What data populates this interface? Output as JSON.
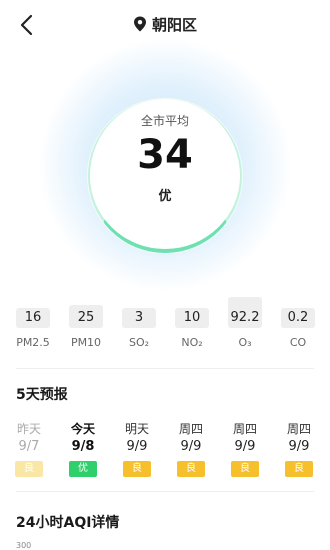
{
  "header": {
    "location": "朝阳区"
  },
  "summary": {
    "label": "全市平均",
    "value": "34",
    "level": "优"
  },
  "pollutants": [
    {
      "label": "PM2.5",
      "value": "16",
      "level": 0.35
    },
    {
      "label": "PM10",
      "value": "25",
      "level": 0.5
    },
    {
      "label": "SO₂",
      "value": "3",
      "level": 0.12
    },
    {
      "label": "NO₂",
      "value": "10",
      "level": 0.25
    },
    {
      "label": "O₃",
      "value": "92.2",
      "level": 0.68
    },
    {
      "label": "CO",
      "value": "0.2",
      "level": 0.12
    }
  ],
  "forecast": {
    "title": "5天预报",
    "days": [
      {
        "day": "昨天",
        "date": "9/7",
        "level": "良",
        "color": "#fbe7a5",
        "state": "past"
      },
      {
        "day": "今天",
        "date": "9/8",
        "level": "优",
        "color": "#2fcf6c",
        "state": "today"
      },
      {
        "day": "明天",
        "date": "9/9",
        "level": "良",
        "color": "#f5c02b",
        "state": "future"
      },
      {
        "day": "周四",
        "date": "9/9",
        "level": "良",
        "color": "#f5c02b",
        "state": "future"
      },
      {
        "day": "周四",
        "date": "9/9",
        "level": "良",
        "color": "#f5c02b",
        "state": "future"
      },
      {
        "day": "周四",
        "date": "9/9",
        "level": "良",
        "color": "#f5c02b",
        "state": "future"
      }
    ]
  },
  "aqi24": {
    "title": "24小时AQI详情",
    "y_tick": "300"
  }
}
